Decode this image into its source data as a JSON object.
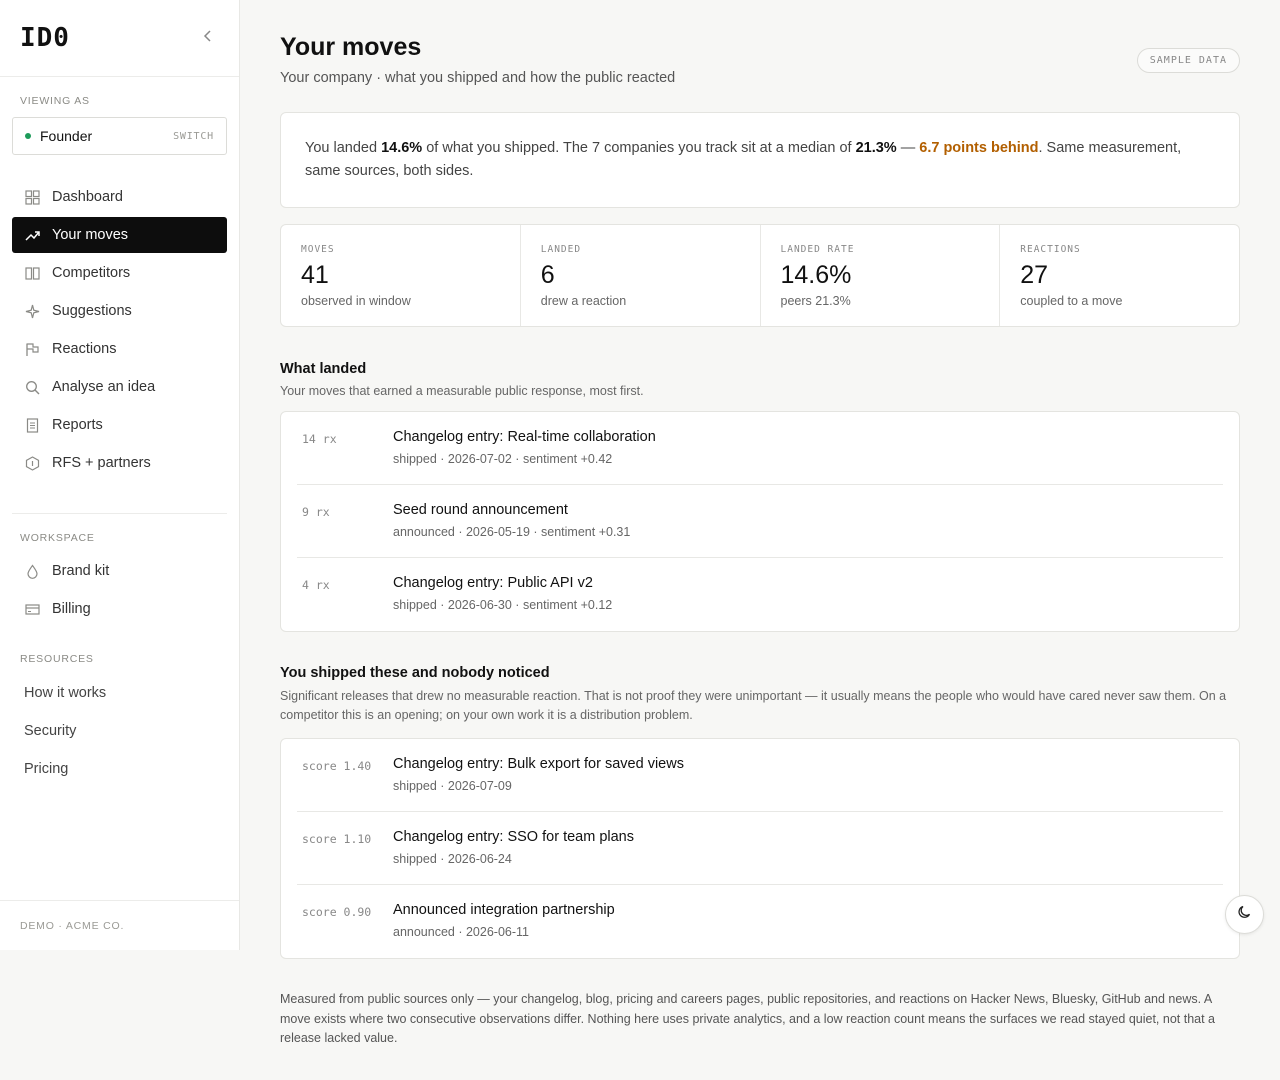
{
  "sidebar": {
    "logo": "ID0",
    "viewing_as_label": "VIEWING AS",
    "viewer": {
      "name": "Founder",
      "switch_label": "SWITCH"
    },
    "nav": [
      {
        "label": "Dashboard",
        "icon": "grid-icon"
      },
      {
        "label": "Your moves",
        "icon": "trend-up-icon",
        "active": true
      },
      {
        "label": "Competitors",
        "icon": "columns-icon"
      },
      {
        "label": "Suggestions",
        "icon": "sparkle-icon"
      },
      {
        "label": "Reactions",
        "icon": "flag-icon"
      },
      {
        "label": "Analyse an idea",
        "icon": "search-icon"
      },
      {
        "label": "Reports",
        "icon": "document-icon"
      },
      {
        "label": "RFS + partners",
        "icon": "hexagon-icon"
      }
    ],
    "workspace_label": "WORKSPACE",
    "workspace": [
      {
        "label": "Brand kit",
        "icon": "drop-icon"
      },
      {
        "label": "Billing",
        "icon": "card-icon"
      }
    ],
    "resources_label": "RESOURCES",
    "resources": [
      {
        "label": "How it works"
      },
      {
        "label": "Security"
      },
      {
        "label": "Pricing"
      }
    ],
    "footer": "DEMO · ACME CO."
  },
  "header": {
    "title": "Your moves",
    "subtitle": "Your company · what you shipped and how the public reacted",
    "badge": "SAMPLE DATA"
  },
  "summary": {
    "p1": "You landed ",
    "landed": "14.6%",
    "p2": " of what you shipped. The 7 companies you track sit at a median of ",
    "median": "21.3%",
    "p3": " — ",
    "behind": "6.7 points behind",
    "p4": ". Same measurement, same sources, both sides."
  },
  "stats": [
    {
      "label": "MOVES",
      "value": "41",
      "sub": "observed in window"
    },
    {
      "label": "LANDED",
      "value": "6",
      "sub": "drew a reaction"
    },
    {
      "label": "LANDED RATE",
      "value": "14.6%",
      "sub": "peers 21.3%"
    },
    {
      "label": "REACTIONS",
      "value": "27",
      "sub": "coupled to a move"
    }
  ],
  "landed": {
    "title": "What landed",
    "description": "Your moves that earned a measurable public response, most first.",
    "items": [
      {
        "meta": "14 rx",
        "title": "Changelog entry: Real-time collaboration",
        "sub": "shipped · 2026-07-02 · sentiment +0.42"
      },
      {
        "meta": "9 rx",
        "title": "Seed round announcement",
        "sub": "announced · 2026-05-19 · sentiment +0.31"
      },
      {
        "meta": "4 rx",
        "title": "Changelog entry: Public API v2",
        "sub": "shipped · 2026-06-30 · sentiment +0.12"
      }
    ]
  },
  "unnoticed": {
    "title": "You shipped these and nobody noticed",
    "description": "Significant releases that drew no measurable reaction. That is not proof they were unimportant — it usually means the people who would have cared never saw them. On a competitor this is an opening; on your own work it is a distribution problem.",
    "items": [
      {
        "meta": "score 1.40",
        "title": "Changelog entry: Bulk export for saved views",
        "sub": "shipped · 2026-07-09"
      },
      {
        "meta": "score 1.10",
        "title": "Changelog entry: SSO for team plans",
        "sub": "shipped · 2026-06-24"
      },
      {
        "meta": "score 0.90",
        "title": "Announced integration partnership",
        "sub": "announced · 2026-06-11"
      }
    ]
  },
  "footnote": "Measured from public sources only — your changelog, blog, pricing and careers pages, public repositories, and reactions on Hacker News, Bluesky, GitHub and news. A move exists where two consecutive observations differ. Nothing here uses private analytics, and a low reaction count means the surfaces we read stayed quiet, not that a release lacked value.",
  "colors": {
    "accent_behind": "#b25f00",
    "active_nav": "#0d0d0d",
    "status_dot": "#1d9b5a"
  }
}
